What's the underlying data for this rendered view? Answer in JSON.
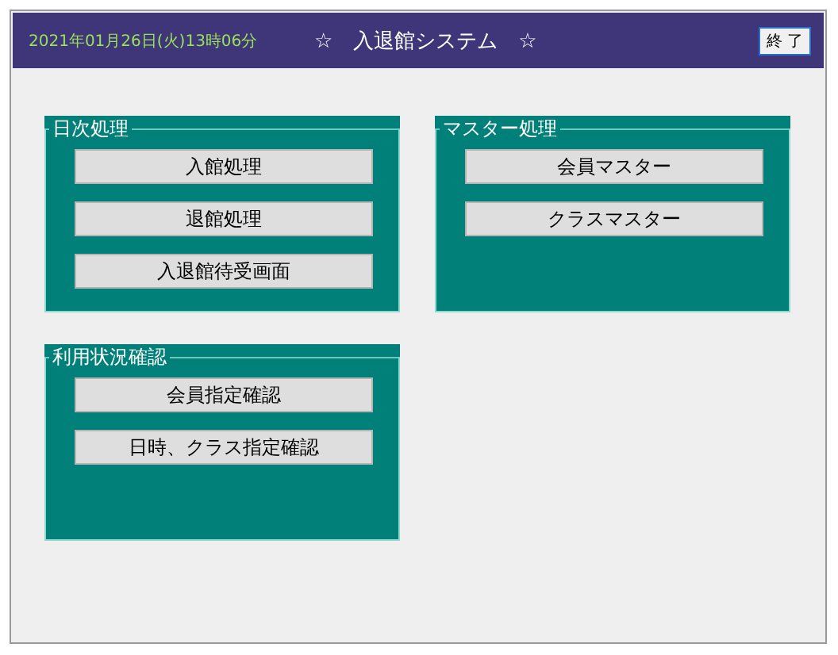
{
  "header": {
    "datetime": "2021年01月26日(火)13時06分",
    "title": "☆　入退館システム　☆",
    "exit_button": "終 了"
  },
  "panels": [
    {
      "title": "日次処理",
      "buttons": [
        "入館処理",
        "退館処理",
        "入退館待受画面"
      ]
    },
    {
      "title": "マスター処理",
      "buttons": [
        "会員マスター",
        "クラスマスター"
      ]
    },
    {
      "title": "利用状況確認",
      "buttons": [
        "会員指定確認",
        "日時、クラス指定確認"
      ]
    }
  ]
}
